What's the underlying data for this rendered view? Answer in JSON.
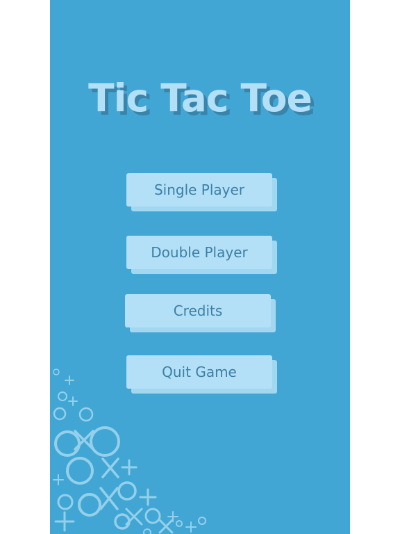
{
  "title": "Tic Tac Toe",
  "menu": {
    "single_player": "Single Player",
    "double_player": "Double Player",
    "credits": "Credits",
    "quit_game": "Quit Game"
  },
  "colors": {
    "background": "#42a6d4",
    "button": "#b3e0f6",
    "button_text": "#3c7fa6",
    "title_shadow": "#3a83aa"
  },
  "decoration": {
    "icon": "xo-pattern-icon"
  }
}
